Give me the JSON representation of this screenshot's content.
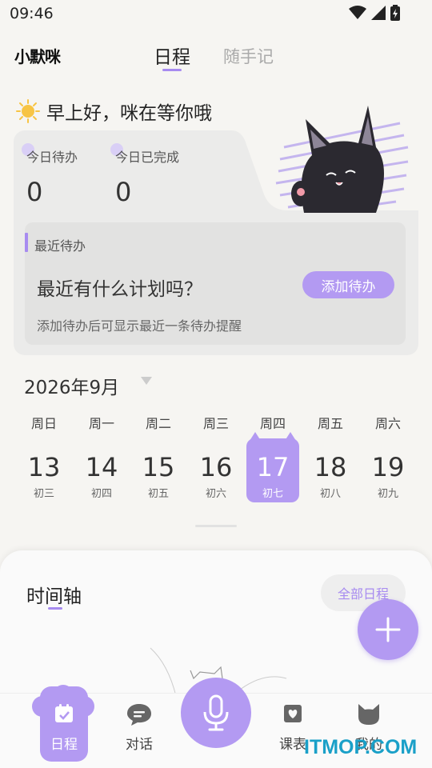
{
  "status_bar": {
    "time": "09:46"
  },
  "header": {
    "brand": "小默咪",
    "tabs": [
      {
        "label": "日程",
        "active": true
      },
      {
        "label": "随手记",
        "active": false
      }
    ]
  },
  "greeting": {
    "text": "早上好，咪在等你哦",
    "icon": "sun-icon"
  },
  "todo_card": {
    "stats": [
      {
        "label": "今日待办",
        "value": "0"
      },
      {
        "label": "今日已完成",
        "value": "0"
      }
    ],
    "recent": {
      "label": "最近待办",
      "question": "最近有什么计划吗？",
      "add_button": "添加待办",
      "hint": "添加待办后可显示最近一条待办提醒"
    }
  },
  "calendar": {
    "month": "2026年9月",
    "weekdays": [
      "周日",
      "周一",
      "周二",
      "周三",
      "周四",
      "周五",
      "周六"
    ],
    "days": [
      {
        "num": "13",
        "lunar": "初三"
      },
      {
        "num": "14",
        "lunar": "初四"
      },
      {
        "num": "15",
        "lunar": "初五"
      },
      {
        "num": "16",
        "lunar": "初六"
      },
      {
        "num": "17",
        "lunar": "初七",
        "selected": true
      },
      {
        "num": "18",
        "lunar": "初八"
      },
      {
        "num": "19",
        "lunar": "初九"
      }
    ]
  },
  "timeline": {
    "title": "时间轴",
    "all_button": "全部日程"
  },
  "bottom_nav": {
    "items": [
      {
        "label": "日程",
        "icon": "calendar-icon",
        "active": true
      },
      {
        "label": "对话",
        "icon": "chat-icon"
      },
      {
        "label": "课表",
        "icon": "course-icon"
      },
      {
        "label": "我的",
        "icon": "cat-profile-icon"
      }
    ],
    "mic_icon": "microphone-icon"
  },
  "watermark": "ITMOP.COM",
  "colors": {
    "accent": "#b39af2",
    "accent_dark": "#a78bf0",
    "background": "#f6f5f2",
    "card": "#ebebea"
  }
}
